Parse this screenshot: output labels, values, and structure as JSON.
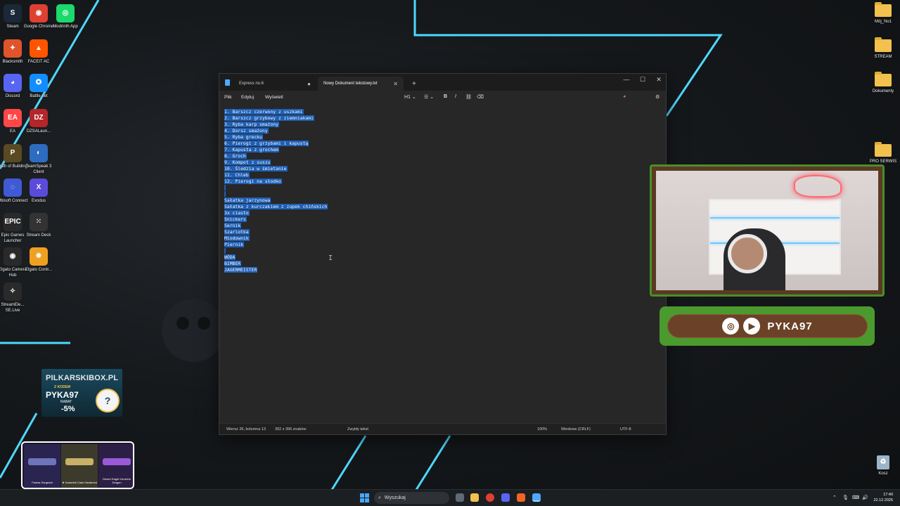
{
  "desktop": {
    "left_icons": [
      {
        "label": "Steam",
        "glyph": "S",
        "color": "#1b2838"
      },
      {
        "label": "Google Chrome",
        "glyph": "◉",
        "color": "#de4032"
      },
      {
        "label": "Modrinth App",
        "glyph": "◎",
        "color": "#1bd96a"
      },
      {
        "label": "Blacksmith",
        "glyph": "✦",
        "color": "#e0542c"
      },
      {
        "label": "FACEIT AC",
        "glyph": "▲",
        "color": "#ff5500"
      },
      {
        "label": "Discord",
        "glyph": "◕",
        "color": "#5865f2"
      },
      {
        "label": "Battle.net",
        "glyph": "✪",
        "color": "#148eff"
      },
      {
        "label": "EA",
        "glyph": "EA",
        "color": "#ff4747"
      },
      {
        "label": "DZSALaun...",
        "glyph": "DZ",
        "color": "#b3262a"
      },
      {
        "label": "Path of Building",
        "glyph": "P",
        "color": "#5a4a22"
      },
      {
        "label": "TeamSpeak 3 Client",
        "glyph": "◐",
        "color": "#2d6cc1"
      },
      {
        "label": "Ubisoft Connect",
        "glyph": "◌",
        "color": "#3f5ad4"
      },
      {
        "label": "Exodus",
        "glyph": "X",
        "color": "#5b4bdb"
      },
      {
        "label": "Epic Games Launcher",
        "glyph": "EPIC",
        "color": "#2a2a2a"
      },
      {
        "label": "Stream Deck",
        "glyph": "⁙",
        "color": "#333333"
      },
      {
        "label": "Elgato Camera Hub",
        "glyph": "◉",
        "color": "#2a2a2a"
      },
      {
        "label": "Elgato Contr...",
        "glyph": "✹",
        "color": "#f0a020"
      },
      {
        "label": "StreamEle... SE.Live",
        "glyph": "✧",
        "color": "#2a2a2a"
      }
    ],
    "right_icons": [
      {
        "label": "Mój_No1"
      },
      {
        "label": "STREAM"
      },
      {
        "label": "Dokumenty"
      },
      {
        "label": "PRO SERWIS"
      }
    ],
    "recycle_bin": "Kosz"
  },
  "notepad": {
    "tabs": [
      {
        "label": "Express no.6",
        "active": false
      },
      {
        "label": "Nowy Dokument tekstowy.txt",
        "active": true
      }
    ],
    "new_tab": "+",
    "window_buttons": {
      "minimize": "—",
      "maximize": "☐",
      "close": "✕"
    },
    "menu": {
      "file": "Plik",
      "edit": "Edytuj",
      "view": "Wyświetl"
    },
    "toolbar": {
      "heading": "H1",
      "list": "☰",
      "bold": "B",
      "italic": "I",
      "link": "⛓",
      "clear": "⌫",
      "copilot": "◕",
      "settings": "⚙"
    },
    "lines": [
      "1. Barszcz czerwony z uszkami",
      "2. Barszcz grzybowy z ziemniakami",
      "3. Ryba karp smażony",
      "4. Dorsz smażony",
      "5. Ryba grecku",
      "6. Pierogi z grzybami i kapustą",
      "7. Kapusta z grochem",
      "8. Groch",
      "9. Kompot z suszu",
      "10. Śledzia w śmietanie",
      "11. Chleb",
      "12. Pierogi na słodko",
      "",
      "",
      "Sałatka jarzynowa",
      "Sałatka z kurczakiem z zupek chińskich",
      "3x ciasto",
      "Snickers",
      "Sernik",
      "Szarlotka",
      "Miodownik",
      "Piernik",
      "",
      "WÓDA",
      "BIMBER",
      "JAGERMEISTER"
    ],
    "status": {
      "position": "Wiersz 26, kolumna 13",
      "chars": "392 z 396 znaków",
      "format": "Zwykły tekst",
      "zoom": "100%",
      "line_ending": "Windows (CRLF)",
      "encoding": "UTF-8"
    }
  },
  "overlay": {
    "handle": "PYKA97",
    "promo": {
      "site": "PILKARSKIBOX.PL",
      "with_code": "Z KODEM",
      "code": "PYKA97",
      "rabat": "RABAT",
      "percent": "-5%"
    },
    "skins": [
      {
        "name": "Famas Sergeant",
        "color": "#6e74b8"
      },
      {
        "name": "★ Karambit Case Hardened",
        "color": "#c8b06a"
      },
      {
        "name": "Desert Eagle Kumicho Dragon",
        "color": "#9a5ad8"
      }
    ]
  },
  "taskbar": {
    "search_placeholder": "Wyszukaj",
    "time": "17:40",
    "date": "22.12.2025"
  }
}
